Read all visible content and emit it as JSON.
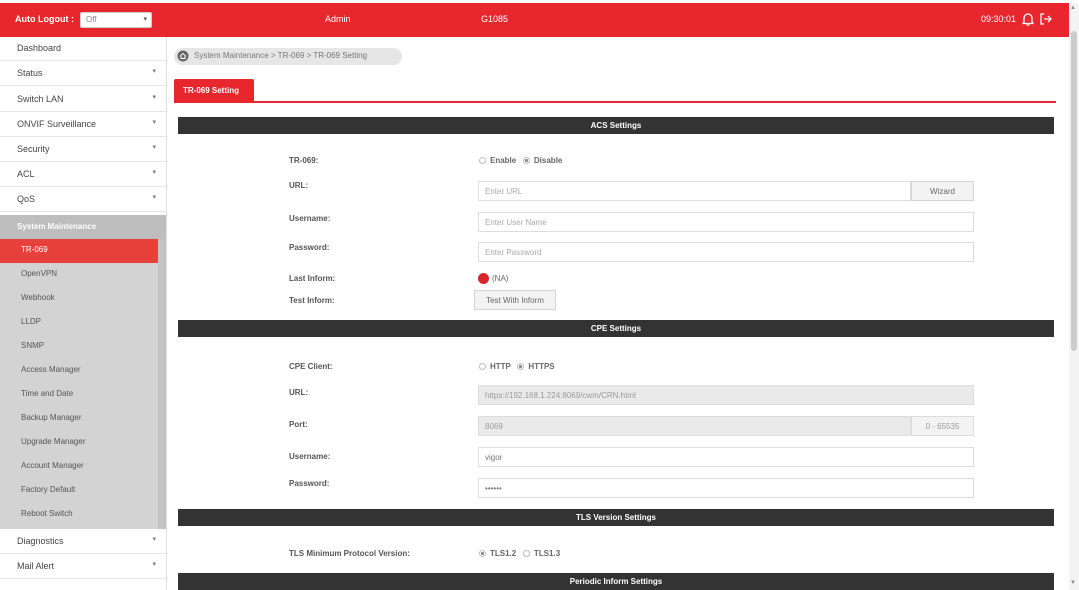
{
  "topbar": {
    "auto_logout_label": "Auto Logout :",
    "auto_logout_value": "Off",
    "user": "Admin",
    "model": "G1085",
    "clock": "09:30:01"
  },
  "sidebar": {
    "items_top": [
      {
        "label": "Dashboard",
        "chev": ""
      },
      {
        "label": "Status",
        "chev": "▾"
      },
      {
        "label": "Switch LAN",
        "chev": "▾"
      },
      {
        "label": "ONVIF Surveillance",
        "chev": "▾"
      },
      {
        "label": "Security",
        "chev": "▾"
      },
      {
        "label": "ACL",
        "chev": "▾"
      },
      {
        "label": "QoS",
        "chev": "▾"
      }
    ],
    "group_label": "System Maintenance",
    "sub_items": [
      "TR-069",
      "OpenVPN",
      "Webhook",
      "LLDP",
      "SNMP",
      "Access Manager",
      "Time and Date",
      "Backup Manager",
      "Upgrade Manager",
      "Account Manager",
      "Factory Default",
      "Reboot Switch"
    ],
    "items_bottom": [
      {
        "label": "Diagnostics",
        "chev": "▾"
      },
      {
        "label": "Mail Alert",
        "chev": "▾"
      }
    ]
  },
  "breadcrumb": "System Maintenance > TR-069 > TR-069 Setting",
  "tab": "TR-069 Setting",
  "acs": {
    "header": "ACS Settings",
    "tr069_label": "TR-069:",
    "enable": "Enable",
    "disable": "Disable",
    "url_label": "URL:",
    "url_placeholder": "Enter URL",
    "wizard": "Wizard",
    "username_label": "Username:",
    "username_placeholder": "Enter User Name",
    "password_label": "Password:",
    "password_placeholder": "Enter Password",
    "last_inform_label": "Last Inform:",
    "last_inform_value": "(NA)",
    "test_inform_label": "Test Inform:",
    "test_button": "Test With Inform"
  },
  "cpe": {
    "header": "CPE Settings",
    "client_label": "CPE Client:",
    "http": "HTTP",
    "https": "HTTPS",
    "url_label": "URL:",
    "url_value": "https://192.168.1.224:8069/cwm/CRN.html",
    "port_label": "Port:",
    "port_value": "8069",
    "port_range": "0 - 65535",
    "username_label": "Username:",
    "username_value": "vigor",
    "password_label": "Password:",
    "password_value": "••••••"
  },
  "tls": {
    "header": "TLS Version Settings",
    "min_label": "TLS Minimum Protocol Version:",
    "v12": "TLS1.2",
    "v13": "TLS1.3"
  },
  "periodic": {
    "header": "Periodic Inform Settings"
  }
}
